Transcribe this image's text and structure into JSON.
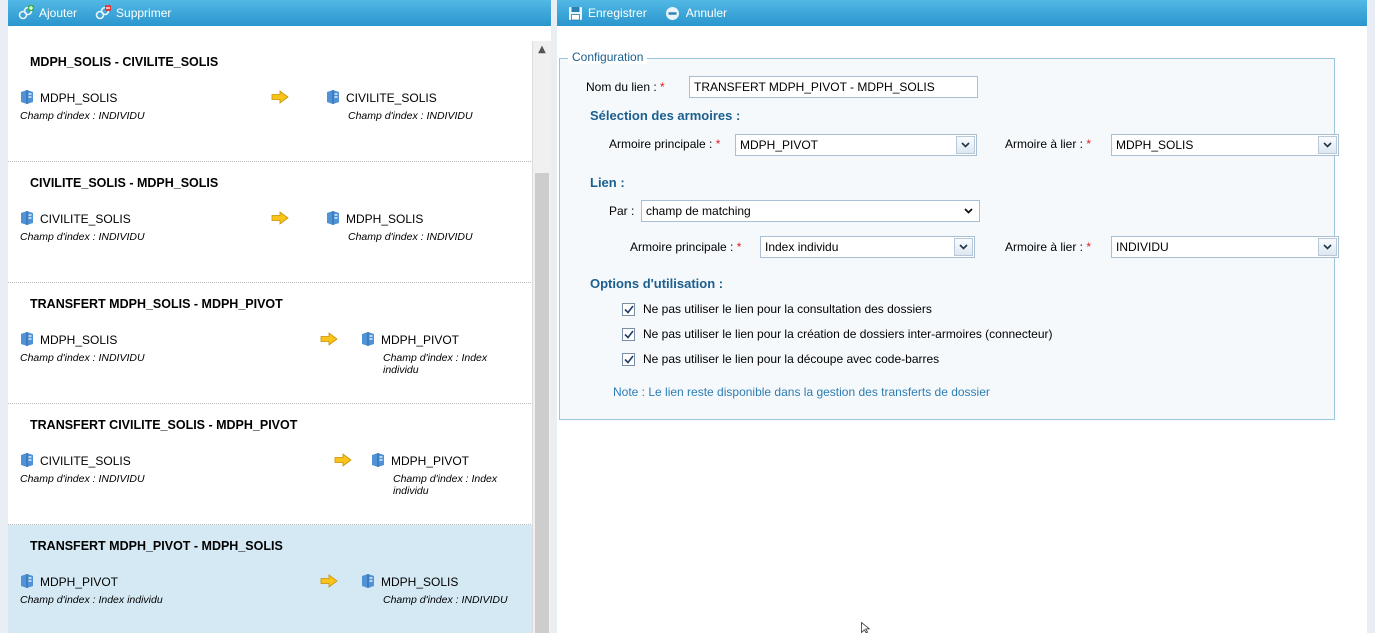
{
  "left_toolbar": {
    "add_label": "Ajouter",
    "delete_label": "Supprimer"
  },
  "right_toolbar": {
    "save_label": "Enregistrer",
    "cancel_label": "Annuler"
  },
  "links": [
    {
      "title": "MDPH_SOLIS - CIVILITE_SOLIS",
      "source": {
        "name": "MDPH_SOLIS",
        "index": "Champ d'index : INDIVIDU"
      },
      "target": {
        "name": "CIVILITE_SOLIS",
        "index": "Champ d'index : INDIVIDU"
      }
    },
    {
      "title": "CIVILITE_SOLIS - MDPH_SOLIS",
      "source": {
        "name": "CIVILITE_SOLIS",
        "index": "Champ d'index : INDIVIDU"
      },
      "target": {
        "name": "MDPH_SOLIS",
        "index": "Champ d'index : INDIVIDU"
      }
    },
    {
      "title": "TRANSFERT MDPH_SOLIS - MDPH_PIVOT",
      "source": {
        "name": "MDPH_SOLIS",
        "index": "Champ d'index : INDIVIDU"
      },
      "target": {
        "name": "MDPH_PIVOT",
        "index": "Champ d'index : Index individu"
      }
    },
    {
      "title": "TRANSFERT CIVILITE_SOLIS - MDPH_PIVOT",
      "source": {
        "name": "CIVILITE_SOLIS",
        "index": "Champ d'index : INDIVIDU"
      },
      "target": {
        "name": "MDPH_PIVOT",
        "index": "Champ d'index : Index individu"
      }
    },
    {
      "title": "TRANSFERT MDPH_PIVOT - MDPH_SOLIS",
      "source": {
        "name": "MDPH_PIVOT",
        "index": "Champ d'index : Index individu"
      },
      "target": {
        "name": "MDPH_SOLIS",
        "index": "Champ d'index : INDIVIDU"
      }
    }
  ],
  "config": {
    "legend": "Configuration",
    "link_name_label": "Nom du lien :",
    "link_name_value": "TRANSFERT MDPH_PIVOT - MDPH_SOLIS",
    "selection_title": "Sélection des armoires :",
    "main_cabinet_label": "Armoire principale :",
    "main_cabinet_value": "MDPH_PIVOT",
    "link_cabinet_label": "Armoire à lier :",
    "link_cabinet_value": "MDPH_SOLIS",
    "link_title": "Lien :",
    "by_label": "Par :",
    "by_value": "champ de matching",
    "main_field_label": "Armoire principale :",
    "main_field_value": "Index individu",
    "link_field_label": "Armoire à lier :",
    "link_field_value": "INDIVIDU",
    "options_title": "Options d'utilisation :",
    "options": [
      "Ne pas utiliser le lien pour la consultation des dossiers",
      "Ne pas utiliser le lien pour la création de dossiers inter-armoires (connecteur)",
      "Ne pas utiliser le lien pour la découpe avec code-barres"
    ],
    "note": "Note : Le lien reste disponible dans la gestion des transferts de dossier"
  },
  "colors": {
    "toolbar": "#2a96cd",
    "selected_row": "#d4e9f3",
    "section": "#1a5f8f",
    "note": "#2d7db3",
    "required": "#e02020"
  }
}
